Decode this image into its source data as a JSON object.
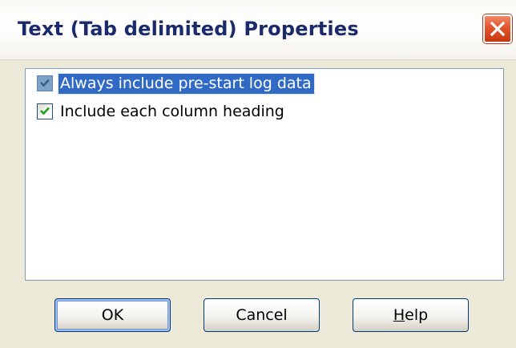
{
  "window": {
    "title": "Text (Tab delimited) Properties"
  },
  "options": [
    {
      "label": "Always include pre-start log data",
      "checked": true,
      "selected": true
    },
    {
      "label": "Include each column heading",
      "checked": true,
      "selected": false
    }
  ],
  "buttons": {
    "ok_label": "OK",
    "cancel_label": "Cancel",
    "help_mnemonic": "H",
    "help_rest": "elp"
  },
  "colors": {
    "selection": "#316ac5",
    "check_green": "#21a121",
    "close_red": "#e0542c",
    "title_text": "#1b2a6b"
  },
  "icons": {
    "close": "close-icon",
    "check": "checkmark-icon"
  }
}
